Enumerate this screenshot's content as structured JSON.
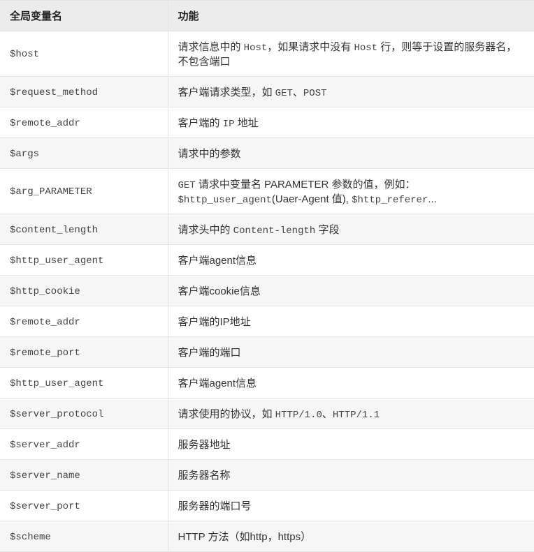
{
  "table": {
    "headers": {
      "var": "全局变量名",
      "desc": "功能"
    },
    "rows": [
      {
        "var": "$host",
        "desc_parts": [
          [
            "请求信息中的 "
          ],
          [
            "Host",
            "mono"
          ],
          [
            "，如果请求中没有 "
          ],
          [
            "Host",
            "mono"
          ],
          [
            " 行，则等于设置的服务器名，不包含端口"
          ]
        ]
      },
      {
        "var": "$request_method",
        "desc_parts": [
          [
            "客户端请求类型，如 "
          ],
          [
            "GET",
            "mono"
          ],
          [
            "、"
          ],
          [
            "POST",
            "mono"
          ]
        ]
      },
      {
        "var": "$remote_addr",
        "desc_parts": [
          [
            "客户端的 "
          ],
          [
            "IP",
            "mono"
          ],
          [
            " 地址"
          ]
        ]
      },
      {
        "var": "$args",
        "desc_parts": [
          [
            "请求中的参数"
          ]
        ]
      },
      {
        "var": "$arg_PARAMETER",
        "desc_parts": [
          [
            "GET",
            "mono"
          ],
          [
            " 请求中变量名 PARAMETER 参数的值，例如："
          ],
          [
            "$http_user_agent",
            "mono"
          ],
          [
            "(Uaer-Agent 值), "
          ],
          [
            "$http_referer",
            "mono"
          ],
          [
            "..."
          ]
        ]
      },
      {
        "var": "$content_length",
        "desc_parts": [
          [
            "请求头中的 "
          ],
          [
            "Content-length",
            "mono"
          ],
          [
            " 字段"
          ]
        ]
      },
      {
        "var": "$http_user_agent",
        "desc_parts": [
          [
            "客户端agent信息"
          ]
        ]
      },
      {
        "var": "$http_cookie",
        "desc_parts": [
          [
            "客户端cookie信息"
          ]
        ]
      },
      {
        "var": "$remote_addr",
        "desc_parts": [
          [
            "客户端的IP地址"
          ]
        ]
      },
      {
        "var": "$remote_port",
        "desc_parts": [
          [
            "客户端的端口"
          ]
        ]
      },
      {
        "var": "$http_user_agent",
        "desc_parts": [
          [
            "客户端agent信息"
          ]
        ]
      },
      {
        "var": "$server_protocol",
        "desc_parts": [
          [
            "请求使用的协议，如 "
          ],
          [
            "HTTP/1.0",
            "mono"
          ],
          [
            "、"
          ],
          [
            "HTTP/1.1",
            "mono"
          ]
        ]
      },
      {
        "var": "$server_addr",
        "desc_parts": [
          [
            "服务器地址"
          ]
        ]
      },
      {
        "var": "$server_name",
        "desc_parts": [
          [
            "服务器名称"
          ]
        ]
      },
      {
        "var": "$server_port",
        "desc_parts": [
          [
            "服务器的端口号"
          ]
        ]
      },
      {
        "var": "$scheme",
        "desc_parts": [
          [
            "HTTP 方法（如http，https）"
          ]
        ]
      }
    ]
  }
}
